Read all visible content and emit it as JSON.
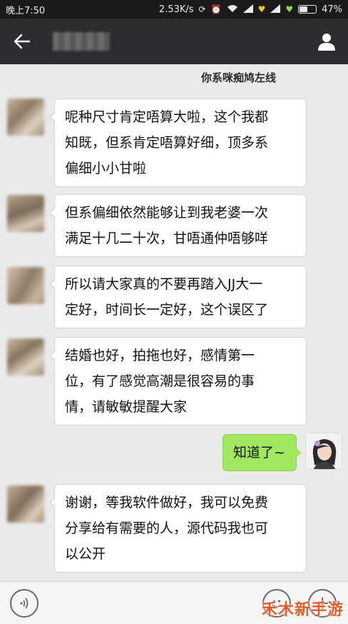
{
  "status_bar": {
    "time": "晚上7:50",
    "speed": "2.53K/s",
    "battery": "47%",
    "battery_level": 0.47
  },
  "header": {
    "back_icon": "arrow-left-icon",
    "profile_icon": "person-icon"
  },
  "caption": "你系咪痴鸠左线",
  "messages": [
    {
      "side": "left",
      "lines": [
        "呢种尺寸肯定唔算大啦，这个我都",
        "知既，但系肯定唔算好细，顶多系",
        "偏细小小甘啦"
      ]
    },
    {
      "side": "left",
      "lines": [
        "但系偏细依然能够让到我老婆一次",
        "满足十几二十次，甘唔通仲唔够咩"
      ]
    },
    {
      "side": "left",
      "lines": [
        "所以请大家真的不要再踏入JJ大一",
        "定好，时间长一定好，这个误区了"
      ]
    },
    {
      "side": "left",
      "lines": [
        "结婚也好，拍拖也好，感情第一",
        "位，有了感觉高潮是很容易的事",
        "情，请敏敏提醒大家"
      ]
    },
    {
      "side": "right",
      "lines": [
        "知道了~"
      ]
    },
    {
      "side": "left",
      "lines": [
        "谢谢，等我软件做好，我可以免费",
        "分享给有需要的人，源代码我也可",
        "以公开"
      ]
    }
  ],
  "watermark": "禾木新手游",
  "colors": {
    "header_bg": "#2d2d30",
    "chat_bg": "#eaeaea",
    "sent_bubble": "#9fe85f",
    "received_bubble": "#ffffff",
    "watermark": "#e35d26"
  }
}
